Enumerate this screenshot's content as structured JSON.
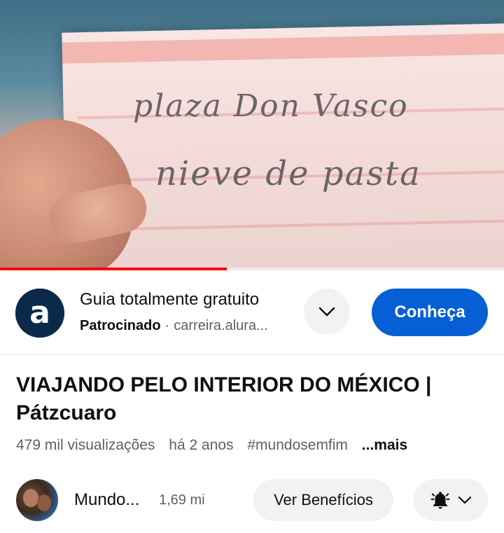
{
  "player": {
    "handwriting_line1": "plaza Don Vasco",
    "handwriting_line2": "nieve de pasta",
    "progress": 0.45,
    "progress_color": "#ff0000"
  },
  "ad": {
    "logo_icon": "alura-logo",
    "logo_letter": "a",
    "title": "Guia totalmente gratuito",
    "sponsored_label": "Patrocinado",
    "separator": "·",
    "url": "carreira.alura...",
    "cta_label": "Conheça",
    "cta_color": "#065fd4"
  },
  "video": {
    "title": "VIAJANDO PELO INTERIOR DO MÉXICO | Pátzcuaro",
    "views": "479 mil visualizações",
    "age": "há 2 anos",
    "hashtag": "#mundosemfim",
    "more_label": "...mais"
  },
  "channel": {
    "name": "Mundo...",
    "subscribers": "1,69 mi",
    "benefits_label": "Ver Benefícios",
    "bell_icon": "bell-icon",
    "chevron_icon": "chevron-down-icon"
  }
}
